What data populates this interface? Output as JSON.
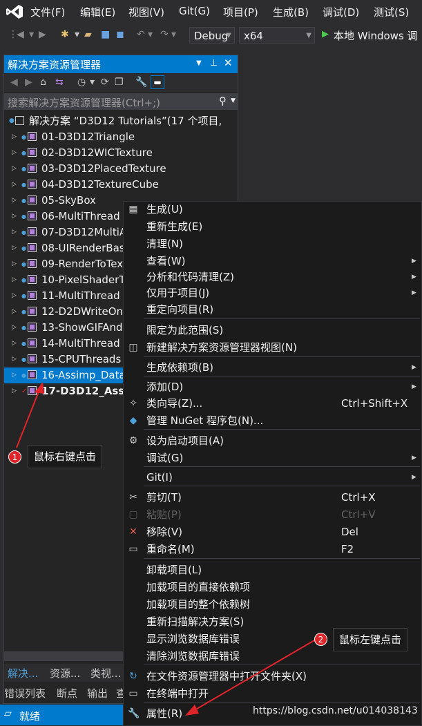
{
  "menubar": {
    "items": [
      "文件(F)",
      "编辑(E)",
      "视图(V)",
      "Git(G)",
      "项目(P)",
      "生成(B)",
      "调试(D)",
      "测试(S)"
    ]
  },
  "toolbar": {
    "config_value": "Debug",
    "platform_value": "x64",
    "run_label": "本地 Windows 调"
  },
  "solution_explorer": {
    "title": "解决方案资源管理器",
    "search_placeholder": "搜索解决方案资源管理器(Ctrl+;)",
    "solution_label": "解决方案 “D3D12 Tutorials”(17 个项目,",
    "projects": [
      "01-D3D12Triangle",
      "02-D3D12WICTexture",
      "03-D3D12PlacedTexture",
      "04-D3D12TextureCube",
      "05-SkyBox",
      "06-MultiThread",
      "07-D3D12MultiA",
      "08-UIRenderBas",
      "09-RenderToTex",
      "10-PixelShaderT",
      "11-MultiThread",
      "12-D2DWriteOn",
      "13-ShowGIFAnd",
      "14-MultiThread",
      "15-CPUThreads",
      "16-Assimp_Data",
      "17-D3D12_Ass"
    ],
    "bottom_tabs": [
      "解决...",
      "资源...",
      "类视..."
    ],
    "output_tabs": [
      "错误列表",
      "断点",
      "输出",
      "查"
    ]
  },
  "status_bar": {
    "text": "就绪"
  },
  "watermark": "https://blog.csdn.net/u014038143",
  "context_menu": {
    "items": [
      {
        "label": "生成(U)",
        "icon": "build-icon"
      },
      {
        "label": "重新生成(E)"
      },
      {
        "label": "清理(N)"
      },
      {
        "label": "查看(W)",
        "submenu": true
      },
      {
        "label": "分析和代码清理(Z)",
        "submenu": true
      },
      {
        "label": "仅用于项目(J)",
        "submenu": true
      },
      {
        "label": "重定向项目(R)"
      },
      {
        "label": "限定为此范围(S)"
      },
      {
        "label": "新建解决方案资源管理器视图(N)",
        "icon": "new-view-icon"
      },
      {
        "label": "生成依赖项(B)",
        "submenu": true
      },
      {
        "label": "添加(D)",
        "submenu": true
      },
      {
        "label": "类向导(Z)...",
        "shortcut": "Ctrl+Shift+X",
        "icon": "class-wizard-icon"
      },
      {
        "label": "管理 NuGet 程序包(N)...",
        "icon": "nuget-icon"
      },
      {
        "label": "设为启动项目(A)",
        "icon": "gear-icon"
      },
      {
        "label": "调试(G)",
        "submenu": true
      },
      {
        "label": "Git(I)",
        "submenu": true
      },
      {
        "label": "剪切(T)",
        "shortcut": "Ctrl+X",
        "icon": "scissors-icon"
      },
      {
        "label": "粘贴(P)",
        "shortcut": "Ctrl+V",
        "icon": "paste-icon",
        "disabled": true
      },
      {
        "label": "移除(V)",
        "shortcut": "Del",
        "icon": "remove-icon"
      },
      {
        "label": "重命名(M)",
        "shortcut": "F2",
        "icon": "rename-icon"
      },
      {
        "label": "卸载项目(L)"
      },
      {
        "label": "加载项目的直接依赖项"
      },
      {
        "label": "加载项目的整个依赖树"
      },
      {
        "label": "重新扫描解决方案(S)"
      },
      {
        "label": "显示浏览数据库错误"
      },
      {
        "label": "清除浏览数据库错误"
      },
      {
        "label": "在文件资源管理器中打开文件夹(X)",
        "icon": "open-folder-icon"
      },
      {
        "label": "在终端中打开",
        "icon": "terminal-icon"
      },
      {
        "label": "属性(R)",
        "icon": "wrench-icon"
      }
    ]
  },
  "annotations": {
    "badge1": "1",
    "callout1": "鼠标右键点击",
    "badge2": "2",
    "callout2": "鼠标左键点击"
  },
  "colors": {
    "accent": "#007acc",
    "annotation": "#e0252a"
  }
}
